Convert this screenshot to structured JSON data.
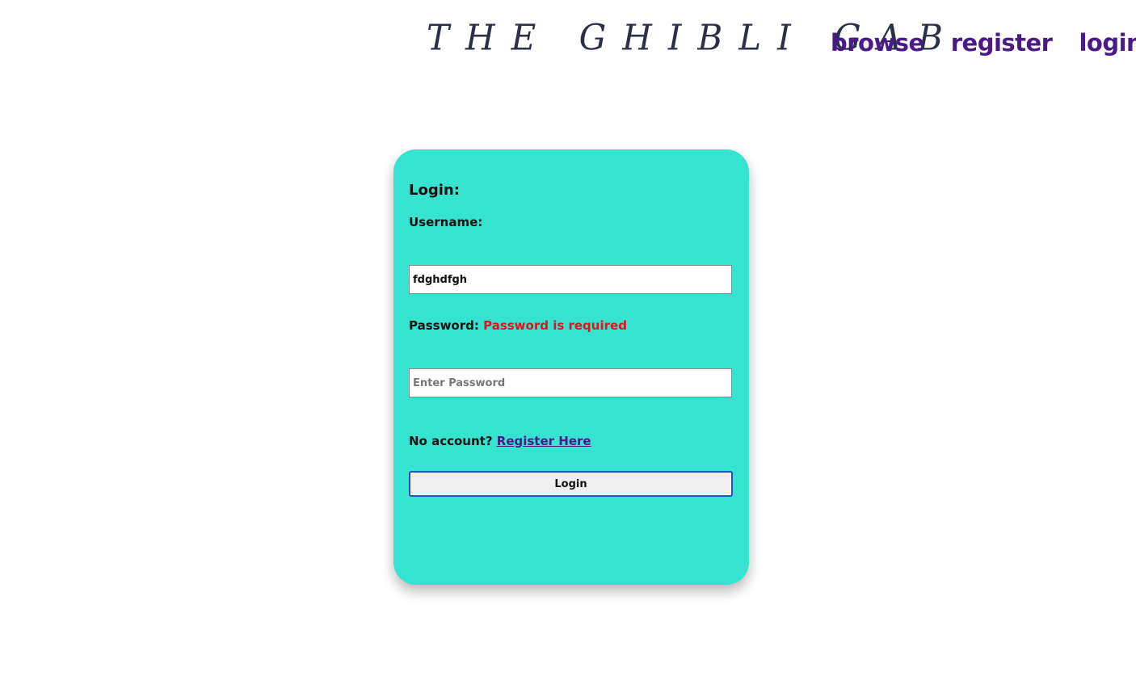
{
  "header": {
    "site_title": "THE GHIBLI GAB",
    "nav": [
      {
        "label": "browse"
      },
      {
        "label": "register"
      },
      {
        "label": "login"
      }
    ]
  },
  "login_form": {
    "title": "Login:",
    "username_label": "Username:",
    "username_value": "fdghdfgh",
    "password_label": "Password:",
    "password_error": "Password is required",
    "password_placeholder": "Enter Password",
    "no_account_text": "No account?",
    "register_link": "Register Here",
    "submit_label": "Login"
  },
  "colors": {
    "card_background": "#36e2d0",
    "nav_link": "#4a1a87",
    "error": "#e0141b",
    "title": "#2b3046"
  }
}
